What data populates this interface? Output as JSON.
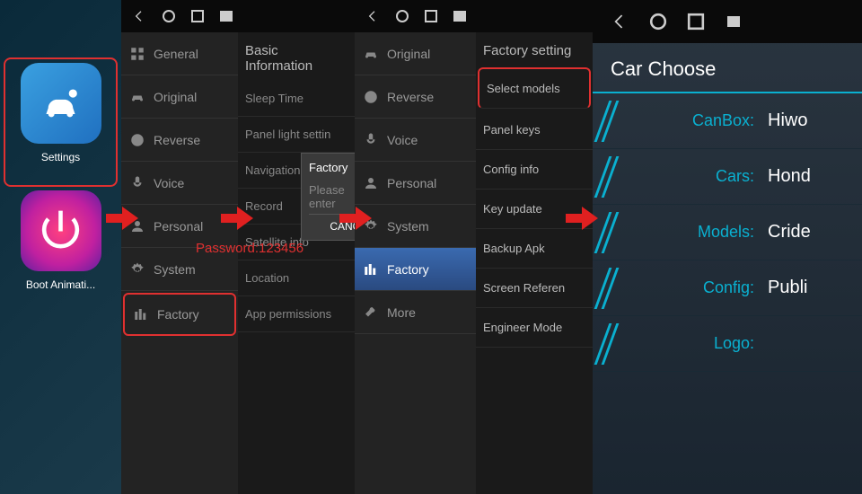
{
  "home": {
    "settings_label": "Settings",
    "boot_label": "Boot Animati..."
  },
  "menu": {
    "items": [
      {
        "label": "General"
      },
      {
        "label": "Original"
      },
      {
        "label": "Reverse"
      },
      {
        "label": "Voice"
      },
      {
        "label": "Personal"
      },
      {
        "label": "System"
      },
      {
        "label": "Factory"
      }
    ]
  },
  "menu3": {
    "items": [
      {
        "label": "Original"
      },
      {
        "label": "Reverse"
      },
      {
        "label": "Voice"
      },
      {
        "label": "Personal"
      },
      {
        "label": "System"
      },
      {
        "label": "Factory"
      },
      {
        "label": "More"
      }
    ]
  },
  "basic": {
    "title": "Basic Information",
    "rows": [
      "Sleep Time",
      "Panel light settin",
      "Navigation",
      "Record",
      "Satellite info",
      "Location",
      "App permissions"
    ]
  },
  "dialog": {
    "title": "Factory",
    "placeholder": "Please enter",
    "cancel": "CANCEL"
  },
  "password_overlay": "Password:123456",
  "factory": {
    "title": "Factory setting",
    "items": [
      "Select models",
      "Panel keys",
      "Config info",
      "Key update",
      "Backup Apk",
      "Screen Referen",
      "Engineer Mode"
    ]
  },
  "carchoose": {
    "title": "Car Choose",
    "rows": [
      {
        "label": "CanBox:",
        "value": "Hiwo"
      },
      {
        "label": "Cars:",
        "value": "Hond"
      },
      {
        "label": "Models:",
        "value": "Cride"
      },
      {
        "label": "Config:",
        "value": "Publi"
      },
      {
        "label": "Logo:",
        "value": ""
      }
    ]
  }
}
